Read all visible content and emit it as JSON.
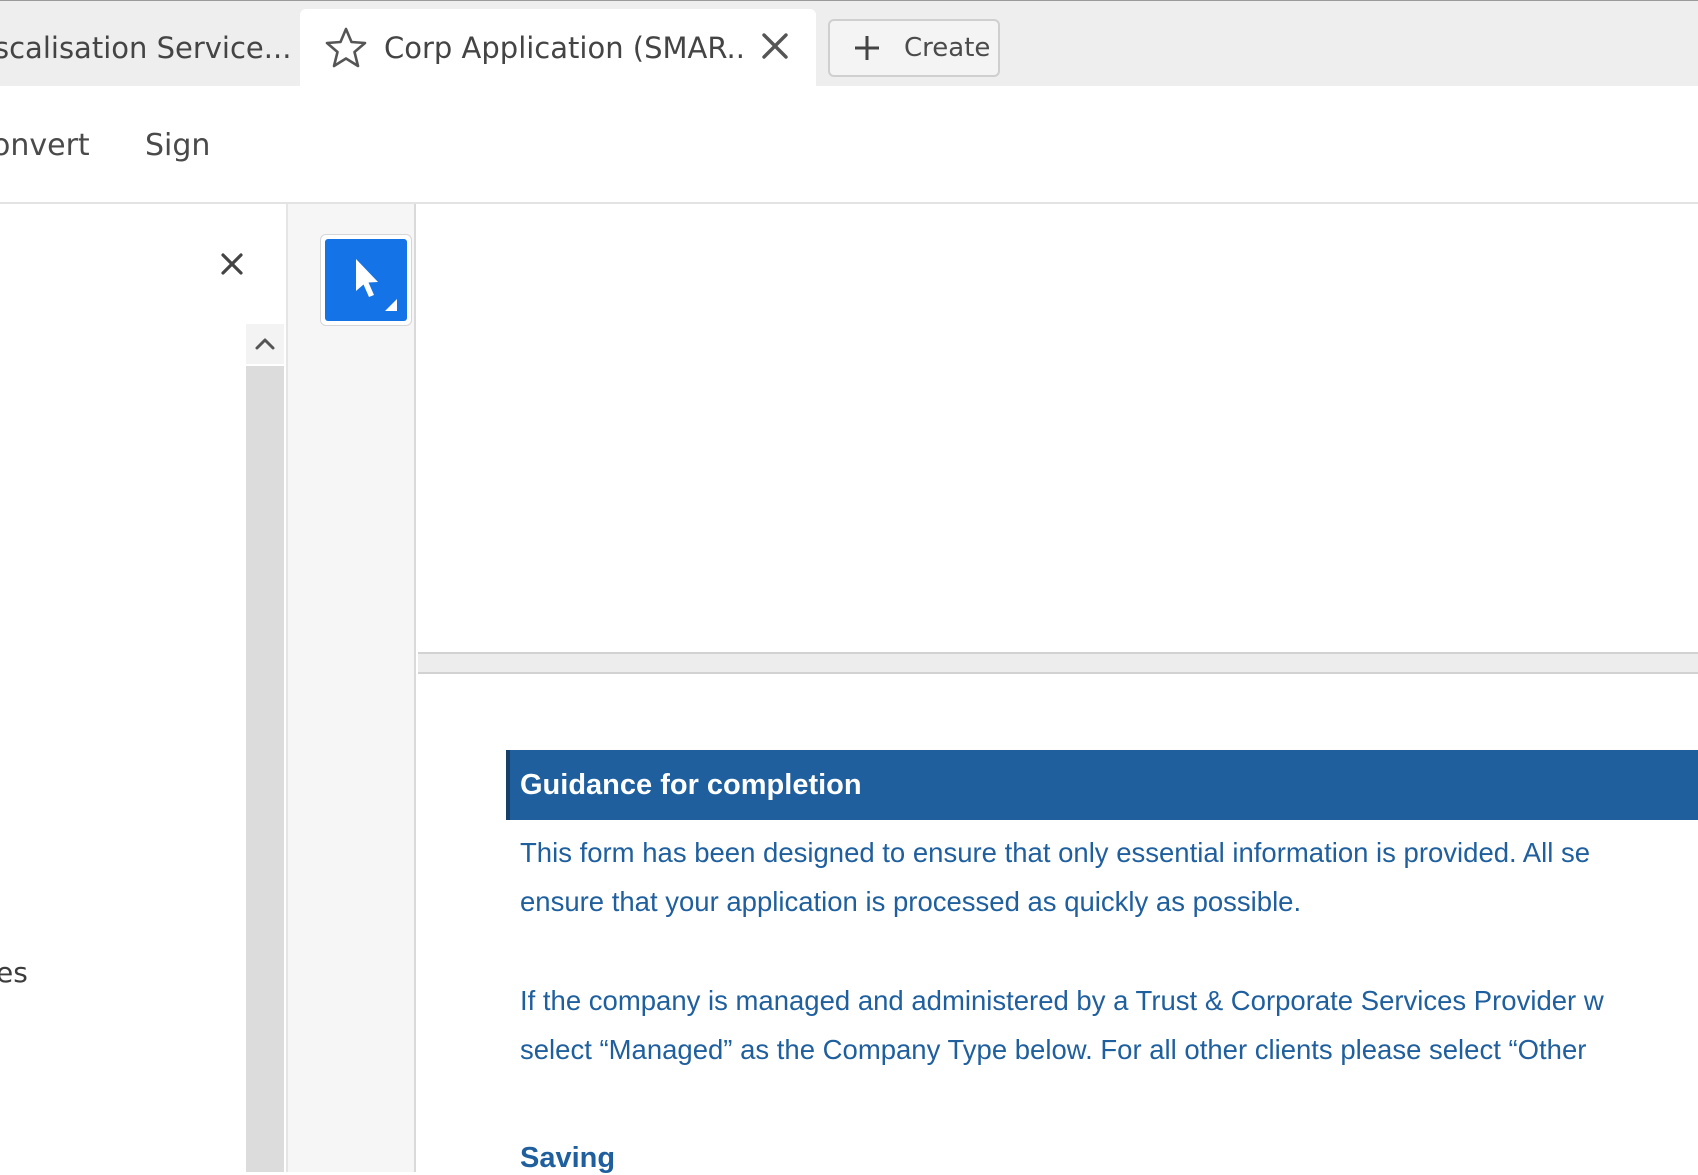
{
  "tabs": [
    {
      "label": "scalisation Service...",
      "active": false
    },
    {
      "label": "Corp Application (SMAR...",
      "active": true
    }
  ],
  "create_button": {
    "label": "Create"
  },
  "toolbar": {
    "convert_label": "onvert",
    "sign_label": "Sign"
  },
  "left_panel": {
    "item_label": "es"
  },
  "colors": {
    "accent_blue": "#1473e6",
    "doc_blue": "#1f5f9e"
  },
  "document": {
    "guidance_title": "Guidance for completion",
    "paragraph1": [
      "This form has been designed to ensure that only essential information is provided.  All se",
      "ensure that your application is processed as quickly as possible."
    ],
    "paragraph2": [
      "If the company is managed and administered by a Trust & Corporate Services Provider w",
      "select “Managed” as the Company Type below.  For all other clients please select “Other"
    ],
    "saving_heading": "Saving"
  },
  "icons": {
    "star": "star-icon",
    "close_tab": "close-icon",
    "plus": "plus-icon",
    "panel_close": "close-icon",
    "scroll_up": "chevron-up-icon",
    "select_tool": "cursor-arrow-icon"
  }
}
